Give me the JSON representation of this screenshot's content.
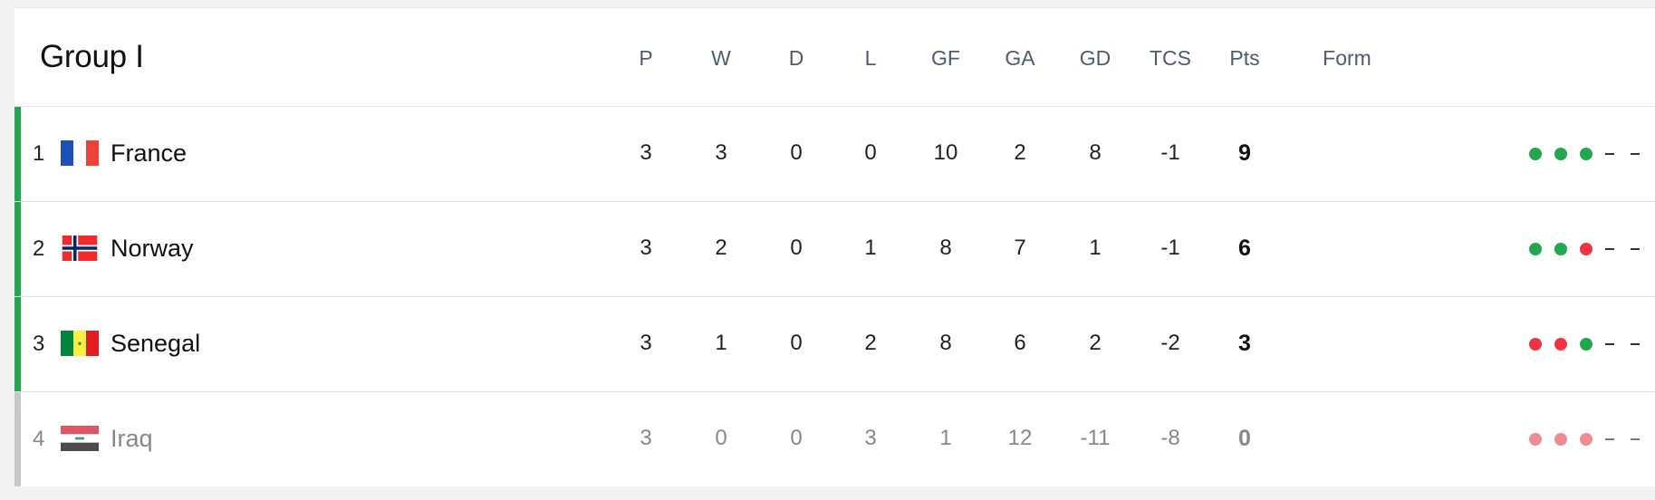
{
  "group": {
    "title": "Group I"
  },
  "columns": [
    "P",
    "W",
    "D",
    "L",
    "GF",
    "GA",
    "GD",
    "TCS",
    "Pts",
    "Form"
  ],
  "colors": {
    "qualify": "#22a650",
    "eliminated": "#c8c8c8",
    "win": "#22a650",
    "loss": "#ee3344",
    "win_faded": "#f08b93"
  },
  "rows": [
    {
      "pos": "1",
      "team": "France",
      "flag": "france-flag",
      "status": "qualify",
      "stats": [
        "3",
        "3",
        "0",
        "0",
        "10",
        "2",
        "8",
        "-1",
        "9"
      ],
      "form": [
        "win",
        "win",
        "win",
        "none",
        "none"
      ]
    },
    {
      "pos": "2",
      "team": "Norway",
      "flag": "norway-flag",
      "status": "qualify",
      "stats": [
        "3",
        "2",
        "0",
        "1",
        "8",
        "7",
        "1",
        "-1",
        "6"
      ],
      "form": [
        "win",
        "win",
        "loss",
        "none",
        "none"
      ]
    },
    {
      "pos": "3",
      "team": "Senegal",
      "flag": "senegal-flag",
      "status": "qualify",
      "stats": [
        "3",
        "1",
        "0",
        "2",
        "8",
        "6",
        "2",
        "-2",
        "3"
      ],
      "form": [
        "loss",
        "loss",
        "win",
        "none",
        "none"
      ]
    },
    {
      "pos": "4",
      "team": "Iraq",
      "flag": "iraq-flag",
      "status": "eliminated",
      "stats": [
        "3",
        "0",
        "0",
        "3",
        "1",
        "12",
        "-11",
        "-8",
        "0"
      ],
      "form": [
        "loss",
        "loss",
        "loss",
        "none",
        "none"
      ]
    }
  ]
}
